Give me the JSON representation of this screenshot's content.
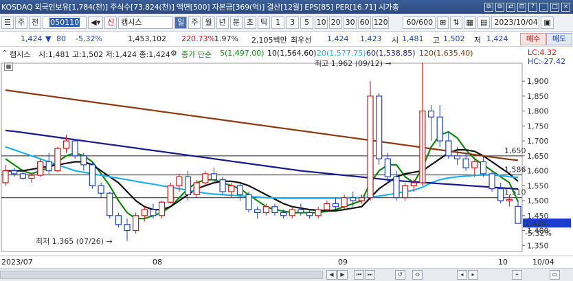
{
  "titlebar": {
    "title": "KOSDAQ 외국인보유[1,784(천)] 주식수[73,824(천)] 액면[500] 자본금[369(억)] 결산[12월] EPS[85] PER[16.71] 시가총",
    "buttons": [
      "⧉",
      "⧉",
      "⇄",
      "⊡",
      "?",
      "_",
      "□",
      "×"
    ]
  },
  "toolbar": {
    "menu_icon": "☰",
    "ju": "주",
    "jeon": "전",
    "code": "050110",
    "speaker": "◀▾",
    "sin": "신",
    "name": "캠시스",
    "periods": [
      "일",
      "주",
      "월",
      "년",
      "분",
      "초",
      "틱"
    ],
    "period_selected": "일",
    "numbers": [
      "1",
      "3",
      "5",
      "10",
      "20",
      "30",
      "60",
      "120"
    ],
    "page": "60/600",
    "date": "2023/10/04"
  },
  "quote": {
    "price": "1,424",
    "arrow": "▼",
    "change": "80",
    "rate": "-5.32%",
    "volume": "1,453,102",
    "vol_ratio": "220.73%",
    "turnover": "1.97%",
    "amount": "2,105백만",
    "best_label": "최우선",
    "ask": "1,424",
    "bid": "1,423",
    "open_label": "시",
    "open": "1,481",
    "high_label": "고",
    "high": "1,502",
    "low_label": "저",
    "low": "1,424",
    "buy": "매수",
    "sell": "매도"
  },
  "legend": {
    "name": "캠시스",
    "ohlc": "시:1,481 고:1,502 저:1,424 종:1,424",
    "ma_type": "종가 단순",
    "ma5": "5(1,497.00)",
    "ma10": "10(1,564.60)",
    "ma20": "20(1,577.75)",
    "ma60": "60(1,538.85)",
    "ma120": "120(1,635.40)",
    "lc": "LC:4.32",
    "hc": "HC:-27.42"
  },
  "chart_data": {
    "type": "candlestick",
    "ylim": [
      1330,
      1960
    ],
    "yticks": [
      "1,900",
      "1,850",
      "1,800",
      "1,750",
      "1,700",
      "1,650",
      "1,600",
      "1,550",
      "1,500",
      "1,450",
      "1,400",
      "1,350"
    ],
    "levels": [
      {
        "label": "1,650",
        "value": 1650
      },
      {
        "label": "1,586",
        "value": 1586
      },
      {
        "label": "1,510",
        "value": 1510
      }
    ],
    "current": {
      "price": "1,424",
      "rate": "-5.32%"
    },
    "high_note": "최고 1,962 (09/12)",
    "low_note": "최저 1,365 (07/26)",
    "xlabels": [
      "2023/07",
      "08",
      "09",
      "10",
      "10/04"
    ],
    "candles": [
      [
        1560,
        1620,
        1550,
        1600
      ],
      [
        1600,
        1610,
        1580,
        1590
      ],
      [
        1590,
        1605,
        1570,
        1575
      ],
      [
        1575,
        1590,
        1560,
        1585
      ],
      [
        1585,
        1640,
        1580,
        1630
      ],
      [
        1630,
        1660,
        1590,
        1600
      ],
      [
        1600,
        1680,
        1595,
        1675
      ],
      [
        1675,
        1720,
        1660,
        1700
      ],
      [
        1700,
        1705,
        1640,
        1650
      ],
      [
        1650,
        1660,
        1600,
        1620
      ],
      [
        1620,
        1630,
        1540,
        1550
      ],
      [
        1550,
        1560,
        1510,
        1525
      ],
      [
        1525,
        1530,
        1440,
        1450
      ],
      [
        1450,
        1460,
        1410,
        1420
      ],
      [
        1420,
        1440,
        1365,
        1400
      ],
      [
        1400,
        1460,
        1390,
        1450
      ],
      [
        1450,
        1480,
        1430,
        1470
      ],
      [
        1470,
        1490,
        1440,
        1450
      ],
      [
        1450,
        1500,
        1440,
        1495
      ],
      [
        1495,
        1560,
        1490,
        1550
      ],
      [
        1550,
        1590,
        1530,
        1580
      ],
      [
        1580,
        1600,
        1500,
        1520
      ],
      [
        1520,
        1570,
        1510,
        1560
      ],
      [
        1560,
        1600,
        1550,
        1590
      ],
      [
        1590,
        1610,
        1560,
        1570
      ],
      [
        1570,
        1580,
        1520,
        1530
      ],
      [
        1530,
        1560,
        1510,
        1550
      ],
      [
        1550,
        1560,
        1500,
        1520
      ],
      [
        1520,
        1530,
        1460,
        1470
      ],
      [
        1470,
        1480,
        1440,
        1460
      ],
      [
        1460,
        1490,
        1450,
        1480
      ],
      [
        1480,
        1490,
        1450,
        1460
      ],
      [
        1460,
        1470,
        1440,
        1450
      ],
      [
        1450,
        1480,
        1440,
        1470
      ],
      [
        1470,
        1490,
        1450,
        1460
      ],
      [
        1460,
        1470,
        1440,
        1450
      ],
      [
        1450,
        1480,
        1440,
        1470
      ],
      [
        1470,
        1500,
        1460,
        1490
      ],
      [
        1490,
        1510,
        1470,
        1480
      ],
      [
        1480,
        1520,
        1470,
        1510
      ],
      [
        1510,
        1530,
        1480,
        1500
      ],
      [
        1500,
        1520,
        1490,
        1510
      ],
      [
        1510,
        1900,
        1500,
        1850
      ],
      [
        1850,
        1860,
        1620,
        1640
      ],
      [
        1640,
        1660,
        1560,
        1580
      ],
      [
        1580,
        1600,
        1500,
        1510
      ],
      [
        1510,
        1560,
        1500,
        1550
      ],
      [
        1550,
        1570,
        1530,
        1560
      ],
      [
        1560,
        1962,
        1550,
        1800
      ],
      [
        1800,
        1820,
        1700,
        1780
      ],
      [
        1780,
        1820,
        1680,
        1700
      ],
      [
        1700,
        1730,
        1640,
        1650
      ],
      [
        1650,
        1680,
        1620,
        1640
      ],
      [
        1640,
        1660,
        1600,
        1610
      ],
      [
        1610,
        1640,
        1580,
        1630
      ],
      [
        1630,
        1650,
        1580,
        1590
      ],
      [
        1590,
        1600,
        1530,
        1540
      ],
      [
        1540,
        1560,
        1490,
        1500
      ],
      [
        1500,
        1520,
        1480,
        1504
      ],
      [
        1481,
        1502,
        1424,
        1424
      ]
    ],
    "series": [
      {
        "name": "5",
        "color": "#0a8a0a",
        "values": [
          1640,
          1620,
          1600,
          1590,
          1600,
          1610,
          1630,
          1650,
          1660,
          1650,
          1630,
          1590,
          1550,
          1500,
          1460,
          1440,
          1440,
          1450,
          1460,
          1480,
          1510,
          1540,
          1560,
          1570,
          1570,
          1560,
          1550,
          1540,
          1520,
          1500,
          1480,
          1470,
          1465,
          1460,
          1460,
          1460,
          1460,
          1465,
          1470,
          1480,
          1490,
          1500,
          1560,
          1600,
          1620,
          1620,
          1580,
          1560,
          1610,
          1680,
          1720,
          1730,
          1710,
          1670,
          1640,
          1620,
          1600,
          1580,
          1560,
          1497
        ]
      },
      {
        "name": "10",
        "color": "#111111",
        "values": [
          1600,
          1600,
          1600,
          1605,
          1610,
          1615,
          1620,
          1625,
          1630,
          1630,
          1620,
          1600,
          1580,
          1560,
          1530,
          1500,
          1480,
          1470,
          1470,
          1480,
          1500,
          1520,
          1540,
          1550,
          1560,
          1565,
          1565,
          1560,
          1550,
          1535,
          1520,
          1505,
          1490,
          1480,
          1475,
          1470,
          1468,
          1466,
          1466,
          1470,
          1475,
          1480,
          1510,
          1540,
          1560,
          1580,
          1590,
          1595,
          1600,
          1620,
          1640,
          1660,
          1670,
          1670,
          1665,
          1650,
          1630,
          1610,
          1590,
          1565
        ]
      },
      {
        "name": "20",
        "color": "#20b0e8",
        "values": [
          1680,
          1670,
          1660,
          1650,
          1640,
          1630,
          1620,
          1610,
          1600,
          1595,
          1590,
          1585,
          1580,
          1575,
          1570,
          1565,
          1560,
          1555,
          1550,
          1545,
          1540,
          1535,
          1530,
          1525,
          1522,
          1520,
          1518,
          1516,
          1514,
          1512,
          1510,
          1509,
          1508,
          1508,
          1508,
          1508,
          1508,
          1508,
          1508,
          1509,
          1510,
          1510,
          1512,
          1515,
          1520,
          1525,
          1530,
          1535,
          1545,
          1560,
          1570,
          1576,
          1580,
          1582,
          1585,
          1586,
          1586,
          1584,
          1580,
          1578
        ]
      },
      {
        "name": "60",
        "color": "#1a1a8c",
        "values": [
          1735,
          1732,
          1728,
          1724,
          1720,
          1716,
          1712,
          1708,
          1704,
          1700,
          1696,
          1692,
          1688,
          1684,
          1680,
          1676,
          1672,
          1668,
          1664,
          1660,
          1656,
          1652,
          1648,
          1644,
          1640,
          1636,
          1632,
          1628,
          1624,
          1620,
          1616,
          1612,
          1608,
          1604,
          1600,
          1597,
          1594,
          1591,
          1588,
          1585,
          1582,
          1579,
          1576,
          1573,
          1570,
          1567,
          1565,
          1563,
          1561,
          1559,
          1557,
          1555,
          1553,
          1551,
          1549,
          1547,
          1545,
          1543,
          1541,
          1539
        ]
      },
      {
        "name": "120",
        "color": "#8b3a10",
        "values": [
          1870,
          1866,
          1862,
          1858,
          1854,
          1850,
          1846,
          1842,
          1838,
          1834,
          1830,
          1826,
          1822,
          1818,
          1814,
          1810,
          1806,
          1802,
          1798,
          1794,
          1790,
          1786,
          1782,
          1778,
          1774,
          1770,
          1766,
          1762,
          1758,
          1754,
          1750,
          1746,
          1742,
          1738,
          1734,
          1730,
          1726,
          1722,
          1718,
          1714,
          1710,
          1706,
          1702,
          1698,
          1694,
          1690,
          1686,
          1682,
          1678,
          1674,
          1670,
          1666,
          1662,
          1658,
          1654,
          1650,
          1646,
          1642,
          1638,
          1635
        ]
      }
    ]
  },
  "colors": {
    "rise": "#e01010",
    "fall": "#1a3fd0",
    "titlebar": "#2c4a7e",
    "current_box": "#1a3fd0"
  },
  "bottombar": {
    "buttons": [
      "◀",
      "▶",
      "⏮",
      "⏭",
      "↺",
      "⇔",
      "◂",
      "▸",
      "⌖",
      "▭"
    ]
  }
}
